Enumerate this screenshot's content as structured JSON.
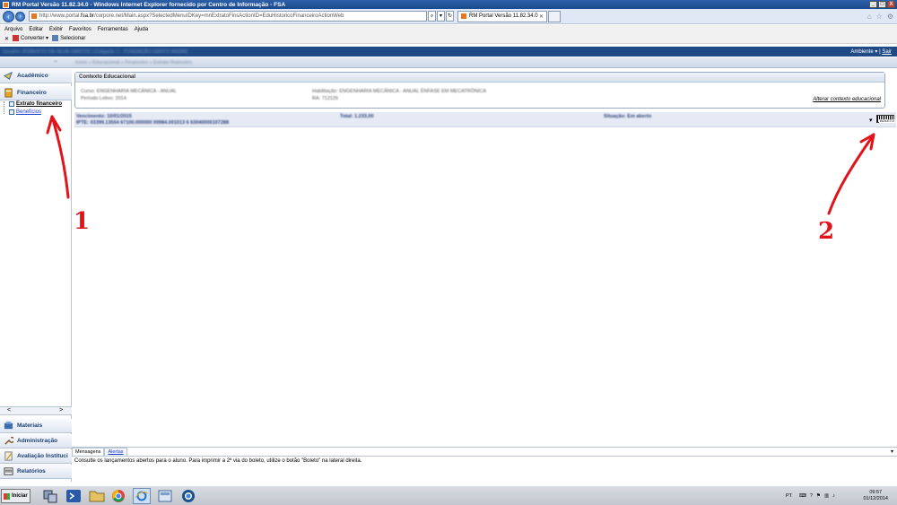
{
  "window": {
    "title": "RM Portal Versão 11.82.34.0 - Windows Internet Explorer fornecido por Centro de Informação - FSA",
    "controls": [
      "_",
      "□",
      "X"
    ]
  },
  "browser": {
    "address_prefix": "http://www.portal.",
    "address_domain": "fsa.br",
    "address_suffix": "/corpore.net/Main.aspx?SelectedMenuIDKey=mnExtratoFinsActionID=EduHistoricoFinanceiroActionWeb",
    "tab_title": "RM Portal Versão 11.82.34.0",
    "menu": [
      "Arquivo",
      "Editar",
      "Exibir",
      "Favoritos",
      "Ferramentas",
      "Ajuda"
    ],
    "command_bar": {
      "convert": "Converter",
      "select": "Selecionar"
    }
  },
  "portal": {
    "header_blurred": "Usuário: ROBERTO DA SILVA SANTOS | Coligada: 1 - FUNDAÇÃO SANTO ANDRÉ",
    "environment": "Ambiente",
    "logout": "Sair",
    "breadcrumb_blurred": "Início » Educacional » Financeiro » Extrato financeiro"
  },
  "sidebar": {
    "sections": {
      "academico": "Acadêmico",
      "financeiro": "Financeiro",
      "materiais": "Materiais",
      "administracao": "Administração",
      "avaliacao": "Avaliação Instituci",
      "relatorios": "Relatórios"
    },
    "tree": {
      "extrato": "Extrato financeiro",
      "beneficios": "Benefícios"
    },
    "scroll_left": "<",
    "scroll_right": ">"
  },
  "context": {
    "title": "Contexto Educacional",
    "curso_blurred": "Curso: ENGENHARIA MECÂNICA - ANUAL",
    "periodo_blurred": "Período Letivo: 2014",
    "habilitacao_blurred": "Habilitação: ENGENHARIA MECÂNICA - ANUAL ÊNFASE EM MECATRÔNICA",
    "ra_blurred": "RA: 712126",
    "alter_link": "Alterar contexto educacional"
  },
  "boleto": {
    "vencimento_blurred": "Vencimento: 10/01/2015",
    "ipte_blurred": "IPTE: 03399.13554 67100.000000 00984.001013 6 63040000107288",
    "total_blurred": "Total: 1.233,00",
    "situacao_blurred": "Situação: Em aberto",
    "icon_label": "BOLETO"
  },
  "annotations": {
    "one": "1",
    "two": "2"
  },
  "messages": {
    "tab_messages": "Mensagens",
    "tab_alerts": "Alertas",
    "text": "Consulte os lançamentos abertos para o aluno. Para imprimir a 2ª via do boleto, utilize o botão \"Boleto\" na lateral direita."
  },
  "taskbar": {
    "start": "Iniciar",
    "lang": "PT",
    "time": "09:57",
    "date": "01/12/2014"
  }
}
